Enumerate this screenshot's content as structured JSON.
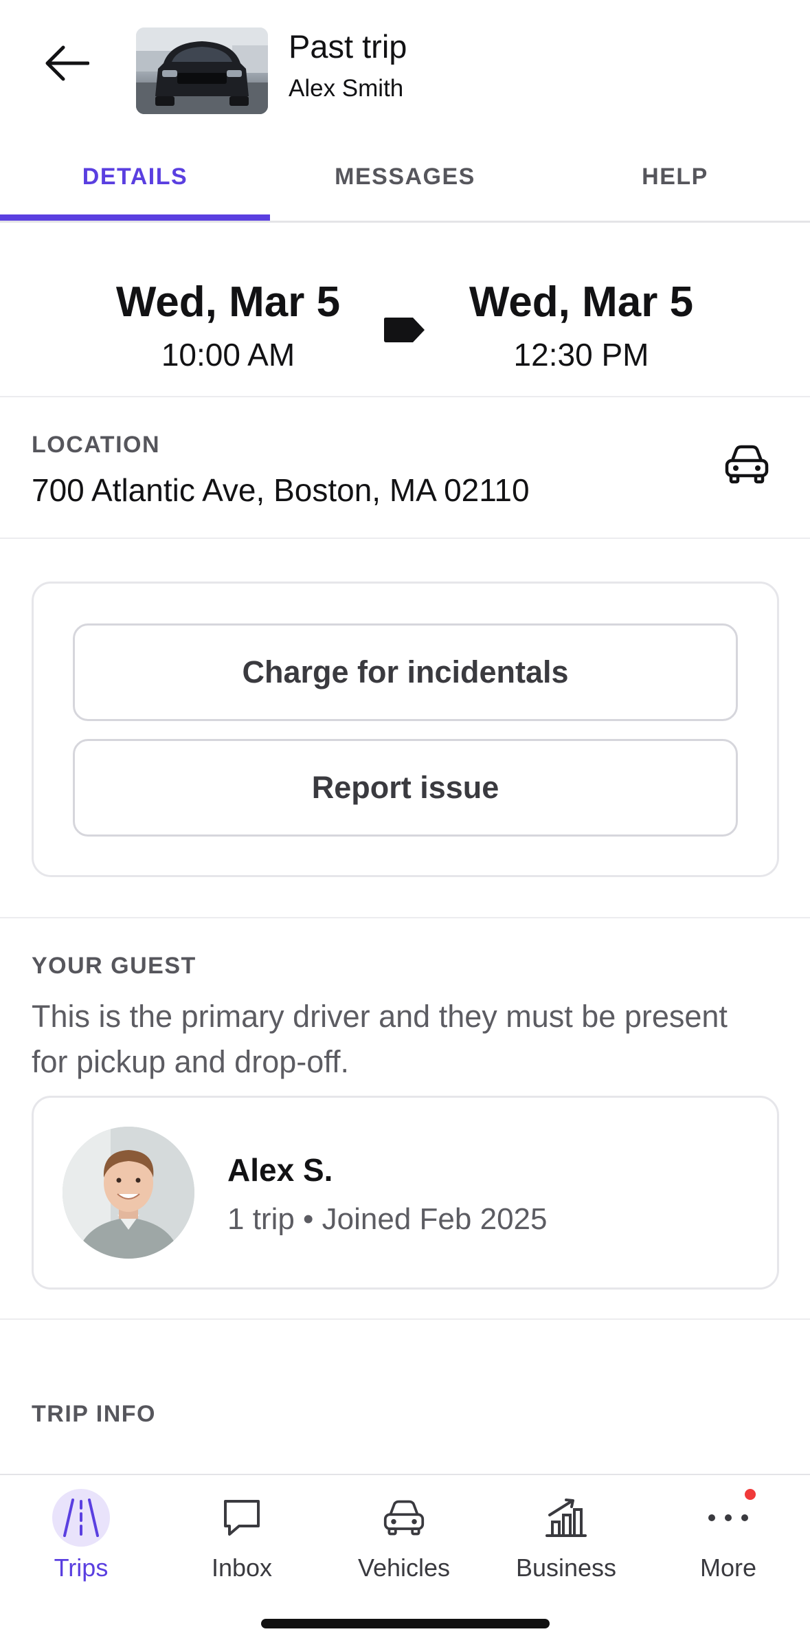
{
  "header": {
    "trip_status": "Past trip",
    "owner_name": "Alex Smith"
  },
  "tabs": [
    {
      "label": "DETAILS",
      "active": true
    },
    {
      "label": "MESSAGES",
      "active": false
    },
    {
      "label": "HELP",
      "active": false
    }
  ],
  "dates": {
    "start_day": "Wed, Mar 5",
    "start_time": "10:00 AM",
    "end_day": "Wed, Mar 5",
    "end_time": "12:30 PM"
  },
  "location": {
    "label": "LOCATION",
    "address": "700 Atlantic Ave, Boston, MA 02110"
  },
  "actions": {
    "charge_label": "Charge for incidentals",
    "report_label": "Report issue"
  },
  "guest": {
    "label": "YOUR GUEST",
    "description": "This is the primary driver and they must be present for pickup and drop-off.",
    "name": "Alex S.",
    "meta": "1 trip • Joined Feb 2025"
  },
  "trip_info": {
    "label": "TRIP INFO"
  },
  "bottom_nav": [
    {
      "label": "Trips",
      "icon": "road-icon",
      "active": true
    },
    {
      "label": "Inbox",
      "icon": "chat-bubble-icon",
      "active": false
    },
    {
      "label": "Vehicles",
      "icon": "car-icon",
      "active": false
    },
    {
      "label": "Business",
      "icon": "chart-growth-icon",
      "active": false
    },
    {
      "label": "More",
      "icon": "more-dots-icon",
      "active": false,
      "notification": true
    }
  ],
  "colors": {
    "accent": "#5a3fe0",
    "text": "#121214",
    "muted": "#5c5c62",
    "badge": "#f03a3a"
  }
}
